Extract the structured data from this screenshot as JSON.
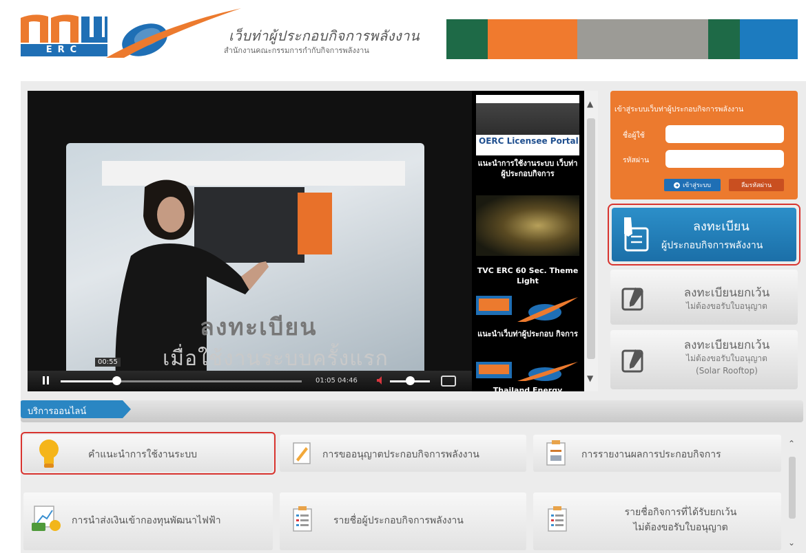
{
  "header": {
    "logo_text": "ERC",
    "site_title": "เว็บท่าผู้ประกอบกิจการพลังงาน",
    "site_subtitle": "สำนักงานคณะกรรมการกำกับกิจการพลังงาน",
    "strip_colors": [
      "#1e6a47",
      "#f07a2e",
      "#9c9b96",
      "#1e6a47",
      "#1c7bbf"
    ]
  },
  "video": {
    "subtitle_line1": "ลงทะเบียน",
    "subtitle_line2": "เมื่อใช้งานระบบครั้งแรก",
    "hover_time": "00:55",
    "current_time": "01:05",
    "duration": "04:46",
    "play_icon": "pause-icon",
    "progress_fraction": 0.23,
    "volume_fraction": 0.5
  },
  "playlist": {
    "items": [
      {
        "label": "แนะนำการใช้งานระบบ เว็บท่าผู้ประกอบกิจการ",
        "thumb_text": "OERC Licensee Portal"
      },
      {
        "label": "TVC ERC 60 Sec. Theme Light"
      },
      {
        "label": "แนะนำเว็บท่าผู้ประกอบ กิจการ"
      },
      {
        "label": "Thailand Energy"
      }
    ]
  },
  "login": {
    "title": "เข้าสู่ระบบเว็บท่าผู้ประกอบกิจการพลังงาน",
    "username_label": "ชื่อผู้ใช้",
    "password_label": "รหัสผ่าน",
    "username_value": "",
    "password_value": "",
    "login_button": "เข้าสู่ระบบ",
    "forgot_button": "ลืมรหัสผ่าน"
  },
  "register": {
    "main_line1": "ลงทะเบียน",
    "main_line2": "ผู้ประกอบกิจการพลังงาน",
    "exempt_line1": "ลงทะเบียนยกเว้น",
    "exempt_line2": "ไม่ต้องขอรับใบอนุญาต",
    "solar_line1": "ลงทะเบียนยกเว้น",
    "solar_line2": "ไม่ต้องขอรับใบอนุญาต",
    "solar_line3": "(Solar Rooftop)"
  },
  "services": {
    "tab_label": "บริการออนไลน์",
    "items": [
      {
        "label": "คำแนะนำการใช้งานระบบ",
        "icon": "lightbulb-icon"
      },
      {
        "label": "การขออนุญาตประกอบกิจการพลังงาน",
        "icon": "document-pen-icon"
      },
      {
        "label": "การรายงานผลการประกอบกิจการ",
        "icon": "report-icon"
      },
      {
        "label": "การนำส่งเงินเข้ากองทุนพัฒนาไฟฟ้า",
        "icon": "money-chart-icon"
      },
      {
        "label": "รายชื่อผู้ประกอบกิจการพลังงาน",
        "icon": "list-icon"
      },
      {
        "label": "รายชื่อกิจการที่ได้รับยกเว้น",
        "label2": "ไม่ต้องขอรับใบอนุญาต",
        "icon": "list-icon"
      }
    ]
  }
}
